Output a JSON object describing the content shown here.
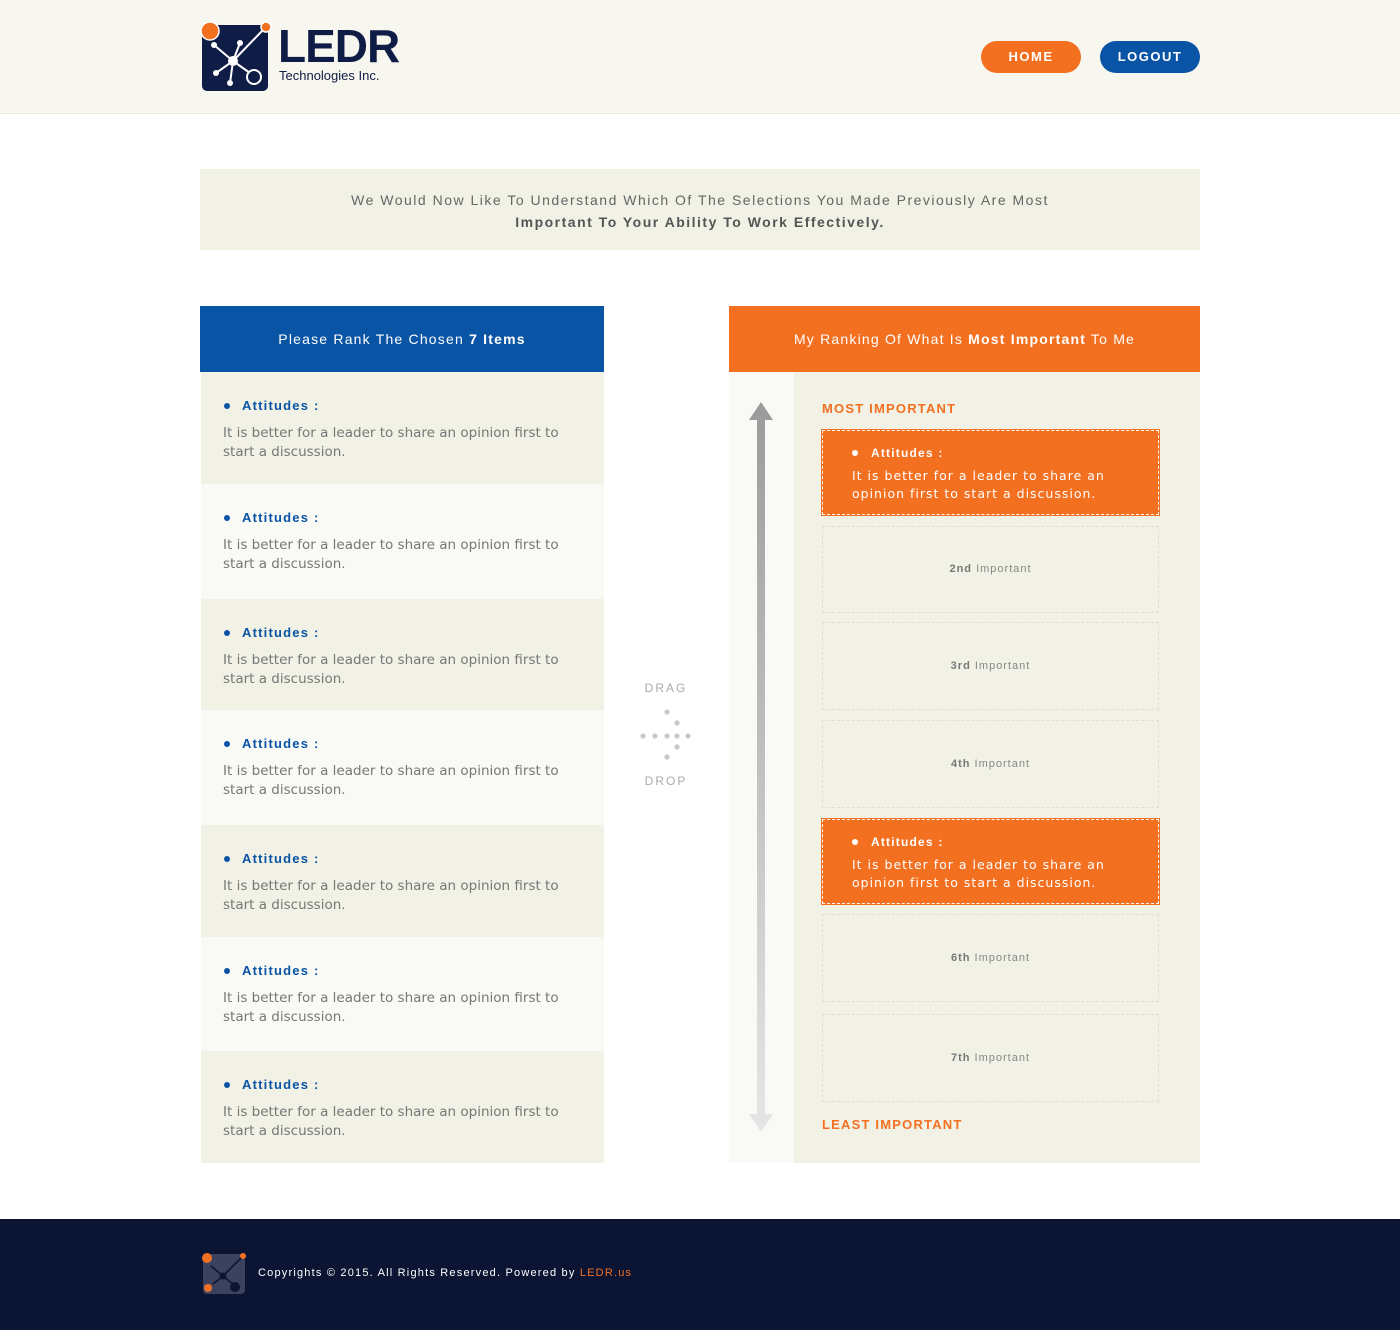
{
  "brand": {
    "name": "LEDR",
    "subtitle": "Technologies Inc.",
    "colors": {
      "orange": "#f37021",
      "blue": "#0a54a5",
      "navy": "#0b1433",
      "beige": "#f2f1e5"
    }
  },
  "nav": {
    "home_label": "HOME",
    "logout_label": "LOGOUT"
  },
  "intro": {
    "line1": "We Would Now Like To Understand Which Of The Selections You Made Previously Are Most",
    "line2": "Important To Your Ability To Work Effectively."
  },
  "left_panel": {
    "header_prefix": "Please Rank The Chosen ",
    "header_bold": "7 Items",
    "items": [
      {
        "title": "Attitudes :",
        "text": "It is better for a leader to share an opinion first to start a discussion."
      },
      {
        "title": "Attitudes :",
        "text": "It is better for a leader to share an opinion first to start a discussion."
      },
      {
        "title": "Attitudes :",
        "text": "It is better for a leader to share an opinion first to start a discussion."
      },
      {
        "title": "Attitudes :",
        "text": "It is better for a leader to share an opinion first to start a discussion."
      },
      {
        "title": "Attitudes :",
        "text": "It is better for a leader to share an opinion first to start a discussion."
      },
      {
        "title": "Attitudes :",
        "text": "It is better for a leader to share an opinion first to start a discussion."
      },
      {
        "title": "Attitudes :",
        "text": "It is better for a leader to share an opinion first to start a discussion."
      }
    ]
  },
  "drag_drop": {
    "top_label": "DRAG",
    "bottom_label": "DROP",
    "icon": "drag-drop-dots-icon"
  },
  "right_panel": {
    "header_prefix": "My Ranking Of What Is ",
    "header_bold": "Most Important",
    "header_suffix": " To Me",
    "top_label": "MOST IMPORTANT",
    "bottom_label": "LEAST IMPORTANT",
    "slots": [
      {
        "filled": true,
        "title": "Attitudes :",
        "text": "It is better for a leader to share an opinion first to start a discussion."
      },
      {
        "filled": false,
        "rank": "2nd",
        "label": " Important"
      },
      {
        "filled": false,
        "rank": "3rd",
        "label": " Important"
      },
      {
        "filled": false,
        "rank": "4th",
        "label": " Important"
      },
      {
        "filled": true,
        "title": "Attitudes :",
        "text": "It is better for a leader to share an opinion first to start a discussion."
      },
      {
        "filled": false,
        "rank": "6th",
        "label": " Important"
      },
      {
        "filled": false,
        "rank": "7th",
        "label": " Important"
      }
    ]
  },
  "footer": {
    "copyright": "Copyrights © 2015. All Rights Reserved. Powered by ",
    "link_text": "LEDR.us"
  }
}
